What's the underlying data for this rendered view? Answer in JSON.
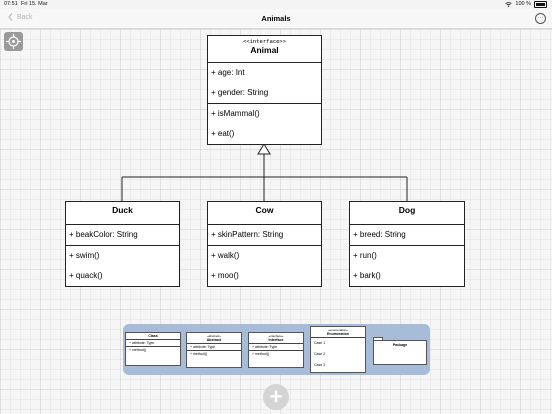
{
  "status_bar": {
    "time": "07:51",
    "date": "Fri 15. Mar",
    "battery": "100 %"
  },
  "nav": {
    "back_label": "Back",
    "title": "Animals",
    "more_icon": "ellipsis-circle-icon"
  },
  "toolbar": {
    "locate_icon": "crosshair-icon"
  },
  "diagram": {
    "animal": {
      "stereotype": "<<interface>>",
      "name": "Animal",
      "attributes": [
        "+ age: Int",
        "+ gender: String"
      ],
      "methods": [
        "+ isMammal()",
        "+ eat()"
      ]
    },
    "duck": {
      "name": "Duck",
      "attributes": [
        "+ beakColor: String"
      ],
      "methods": [
        "+ swim()",
        "+ quack()"
      ]
    },
    "cow": {
      "name": "Cow",
      "attributes": [
        "+ skinPattern: String"
      ],
      "methods": [
        "+ walk()",
        "+ moo()"
      ]
    },
    "dog": {
      "name": "Dog",
      "attributes": [
        "+ breed: String"
      ],
      "methods": [
        "+ run()",
        "+ bark()"
      ]
    }
  },
  "palette": {
    "class": {
      "name": "Class",
      "attribute": "+ attribute: Type",
      "method": "+ method()"
    },
    "abstract": {
      "stereotype": "«abstract»",
      "name": "Abstract",
      "attribute": "+ attribute: Type",
      "method": "+ method()"
    },
    "interface": {
      "stereotype": "«interface»",
      "name": "Interface",
      "attribute": "+ attribute: Type",
      "method": "+ method()"
    },
    "enumeration": {
      "stereotype": "«enumeration»",
      "name": "Enumeration",
      "cases": [
        "Case 1",
        "Case 2",
        "Case 3"
      ]
    },
    "package": {
      "name": "Package"
    }
  },
  "add_button": {
    "label": "+"
  },
  "colors": {
    "palette_bg": "#a6bcd9",
    "canvas_bg": "#f6f6f6",
    "grid_major": "#c9c9c9"
  }
}
